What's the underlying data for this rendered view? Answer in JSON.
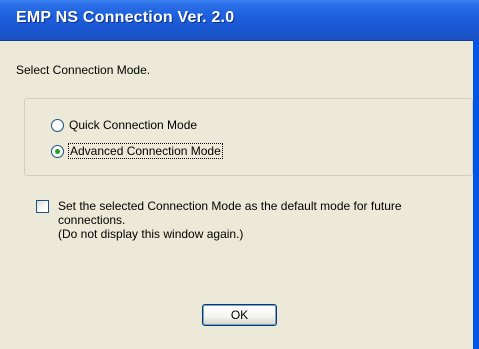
{
  "window": {
    "title": "EMP NS Connection Ver. 2.0"
  },
  "prompt": "Select Connection Mode.",
  "modes": [
    {
      "label": "Quick Connection Mode",
      "selected": false
    },
    {
      "label": "Advanced Connection Mode",
      "selected": true
    }
  ],
  "default_checkbox": {
    "checked": false,
    "lines": [
      "Set the selected Connection Mode as the default mode for future",
      "connections.",
      "(Do not display this window again.)"
    ]
  },
  "buttons": {
    "ok_label": "OK"
  },
  "colors": {
    "titlebar": "#1d5ddb",
    "window_bg": "#ece9d8",
    "radio_dot": "#21a121",
    "frame_edge": "#0055e5"
  }
}
